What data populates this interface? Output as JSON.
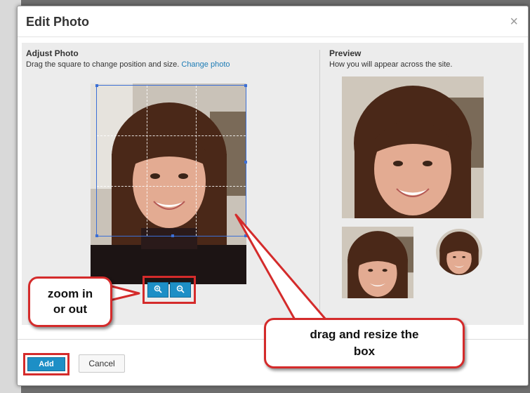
{
  "dialog": {
    "title": "Edit Photo",
    "close_glyph": "×"
  },
  "adjust": {
    "title": "Adjust Photo",
    "subtitle": "Drag the square to change position and size.",
    "link": "Change photo"
  },
  "preview": {
    "title": "Preview",
    "subtitle": "How you will appear across the site."
  },
  "zoom": {
    "in_icon": "zoom-in-icon",
    "out_icon": "zoom-out-icon"
  },
  "footer": {
    "add_label": "Add",
    "cancel_label": "Cancel"
  },
  "annotations": {
    "zoom_line1": "zoom in",
    "zoom_line2": "or out",
    "drag_line1": "drag and resize the",
    "drag_line2": "box"
  },
  "colors": {
    "accent": "#1d8fc6",
    "highlight": "#d42b2b",
    "link": "#1c7bb5",
    "crop_border": "#3b6fd6"
  }
}
